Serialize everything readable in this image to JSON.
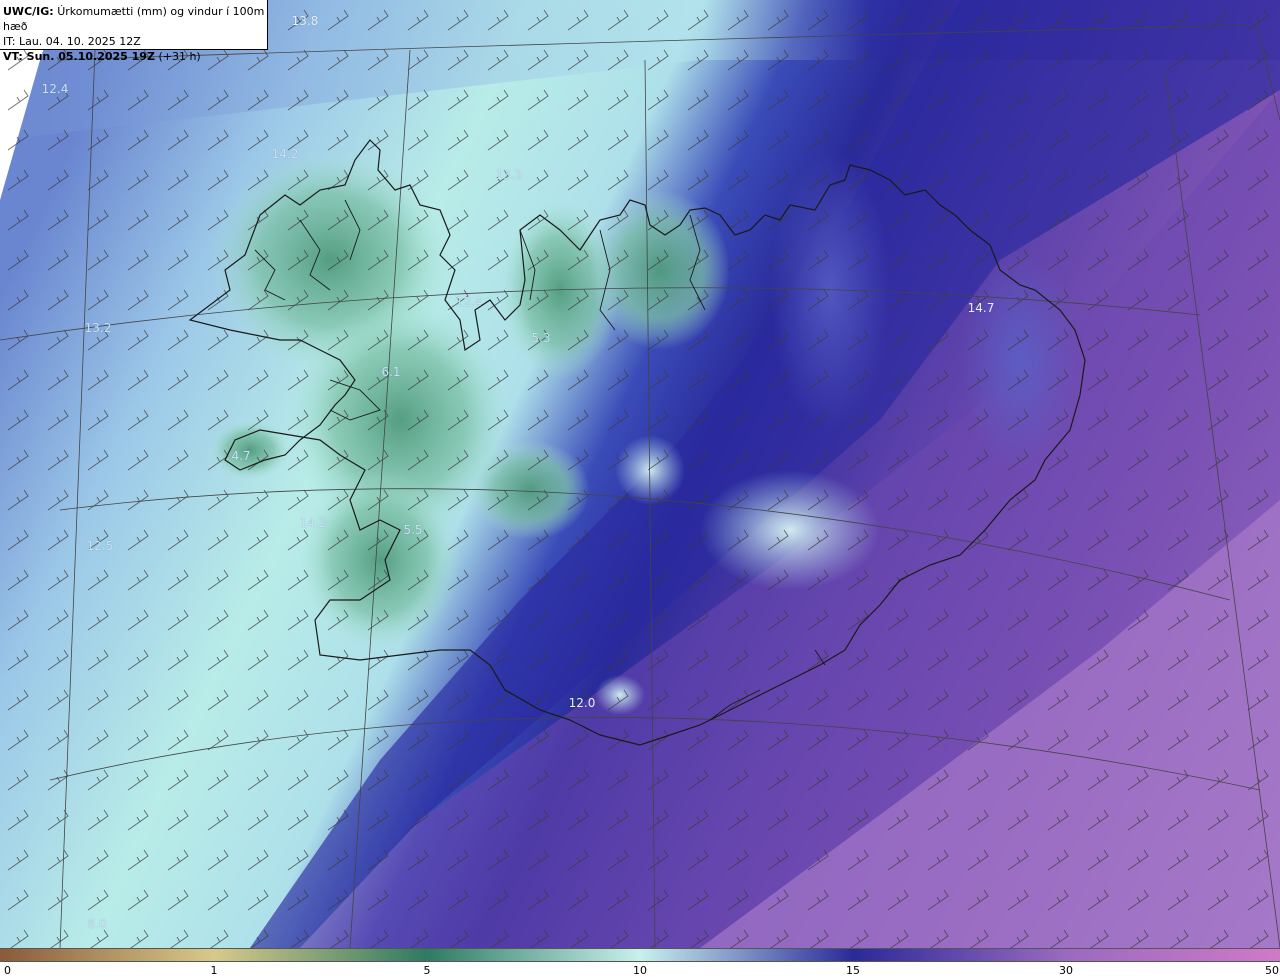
{
  "header": {
    "product_code": "UWC/IG:",
    "description": "Úrkomumætti (mm) og vindur í 100m hæð",
    "issue_time": "IT: Lau. 04. 10. 2025 12Z",
    "valid_prefix": "VT: Sun. 05.10.2025 19Z",
    "valid_lead": "(+31 h)"
  },
  "map_labels": [
    "13.8",
    "12.4",
    "14.2",
    "13.3",
    "12.4",
    "13.2",
    "14.2",
    "12.5",
    "8.0",
    "12.0",
    "14.7",
    "6.1",
    "5.5",
    "4.7",
    "5.3"
  ],
  "colorbar": {
    "ticks": [
      "0",
      "1",
      "5",
      "10",
      "15",
      "30",
      "50"
    ],
    "colors": {
      "dry": "#8a5a3a",
      "low": "#d8c98a",
      "mid_green": "#2f7a62",
      "light": "#c8f0ec",
      "blue": "#2a2a9a",
      "purple": "#9a6ac0",
      "magenta": "#d079c8"
    }
  },
  "legend": {
    "land_outline_color": "#1a1a1a",
    "graticule_color": "#444444",
    "wind_barb_color": "#3a3a3a"
  }
}
